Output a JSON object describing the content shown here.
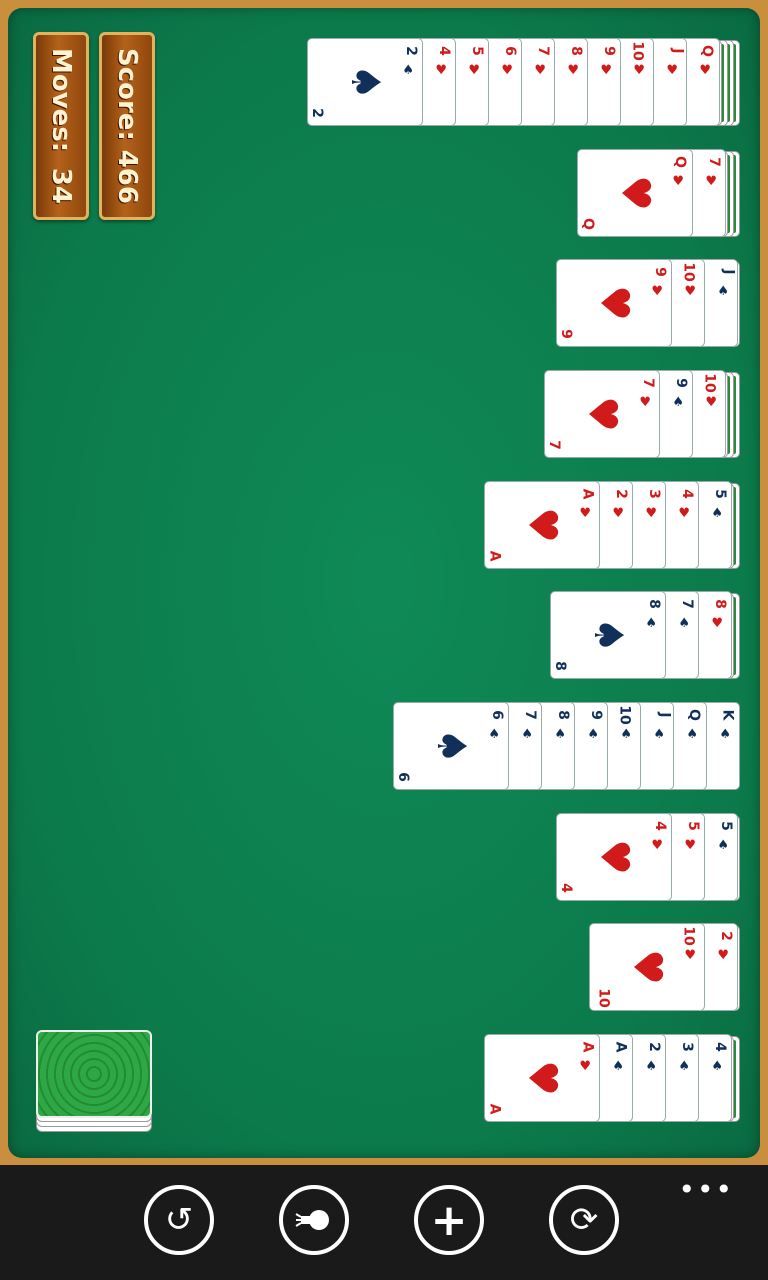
{
  "hud": {
    "score_label": "Score:",
    "score_value": "466",
    "moves_label": "Moves:",
    "moves_value": "34"
  },
  "colors": {
    "felt": "#0c7a4b",
    "frame": "#c98f3e",
    "panel": "#9a4f12",
    "red": "#d11a1a",
    "black": "#10305a"
  },
  "tableau": [
    {
      "facedown": 4,
      "cards": [
        {
          "r": "Q",
          "s": "♥"
        },
        {
          "r": "J",
          "s": "♥"
        },
        {
          "r": "10",
          "s": "♥"
        },
        {
          "r": "9",
          "s": "♥"
        },
        {
          "r": "8",
          "s": "♥"
        },
        {
          "r": "7",
          "s": "♥"
        },
        {
          "r": "6",
          "s": "♥"
        },
        {
          "r": "5",
          "s": "♥"
        },
        {
          "r": "4",
          "s": "♥"
        },
        {
          "r": "2",
          "s": "♠"
        }
      ]
    },
    {
      "facedown": 3,
      "cards": [
        {
          "r": "7",
          "s": "♥"
        },
        {
          "r": "Q",
          "s": "♥"
        }
      ]
    },
    {
      "facedown": 1,
      "cards": [
        {
          "r": "J",
          "s": "♠"
        },
        {
          "r": "10",
          "s": "♥"
        },
        {
          "r": "9",
          "s": "♥"
        }
      ]
    },
    {
      "facedown": 3,
      "cards": [
        {
          "r": "10",
          "s": "♥"
        },
        {
          "r": "9",
          "s": "♠"
        },
        {
          "r": "7",
          "s": "♥"
        }
      ]
    },
    {
      "facedown": 2,
      "cards": [
        {
          "r": "5",
          "s": "♠"
        },
        {
          "r": "4",
          "s": "♥"
        },
        {
          "r": "3",
          "s": "♥"
        },
        {
          "r": "2",
          "s": "♥"
        },
        {
          "r": "A",
          "s": "♥"
        }
      ]
    },
    {
      "facedown": 2,
      "cards": [
        {
          "r": "8",
          "s": "♥"
        },
        {
          "r": "7",
          "s": "♠"
        },
        {
          "r": "8",
          "s": "♠"
        }
      ]
    },
    {
      "facedown": 0,
      "cards": [
        {
          "r": "K",
          "s": "♠"
        },
        {
          "r": "Q",
          "s": "♠"
        },
        {
          "r": "J",
          "s": "♠"
        },
        {
          "r": "10",
          "s": "♠"
        },
        {
          "r": "9",
          "s": "♠"
        },
        {
          "r": "8",
          "s": "♠"
        },
        {
          "r": "7",
          "s": "♠"
        },
        {
          "r": "6",
          "s": "♠"
        }
      ]
    },
    {
      "facedown": 1,
      "cards": [
        {
          "r": "5",
          "s": "♠"
        },
        {
          "r": "5",
          "s": "♥"
        },
        {
          "r": "4",
          "s": "♥"
        }
      ]
    },
    {
      "facedown": 1,
      "cards": [
        {
          "r": "2",
          "s": "♥"
        },
        {
          "r": "10",
          "s": "♥"
        }
      ]
    },
    {
      "facedown": 2,
      "cards": [
        {
          "r": "4",
          "s": "♠"
        },
        {
          "r": "3",
          "s": "♠"
        },
        {
          "r": "2",
          "s": "♠"
        },
        {
          "r": "A",
          "s": "♠"
        },
        {
          "r": "A",
          "s": "♥"
        }
      ]
    }
  ],
  "stock": {
    "icon": "card-back-icon"
  },
  "toolbar": {
    "undo": "↺",
    "hint": "hint-icon",
    "deal": "+",
    "restart": "⟳",
    "more": "•••"
  }
}
